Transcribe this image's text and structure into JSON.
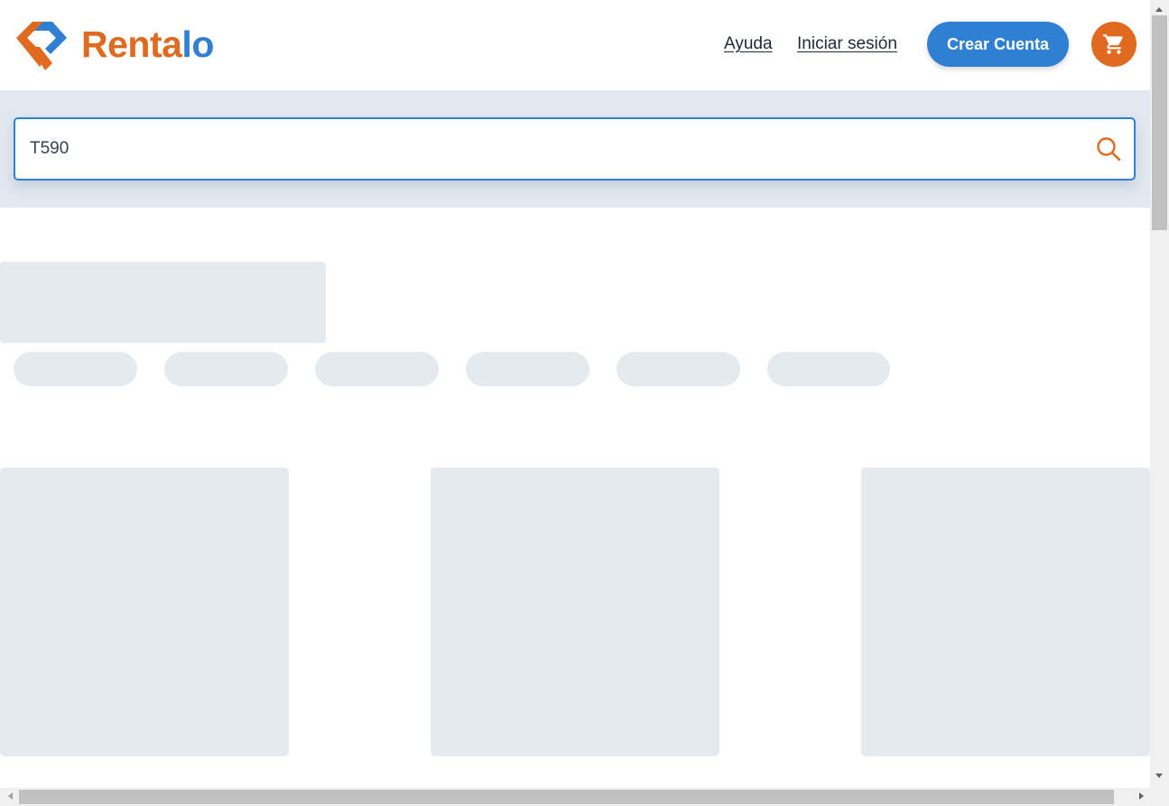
{
  "brand": {
    "name_part1": "Renta",
    "name_part2": "lo",
    "primary_color": "#e06a1f",
    "secondary_color": "#2f80d2"
  },
  "nav": {
    "help_label": "Ayuda",
    "login_label": "Iniciar sesión",
    "create_account_label": "Crear Cuenta",
    "cart_icon": "cart-icon"
  },
  "search": {
    "value": "T590",
    "icon": "search-icon"
  },
  "colors": {
    "search_band": "#e2e8f0",
    "skeleton": "#e5eaf1"
  }
}
